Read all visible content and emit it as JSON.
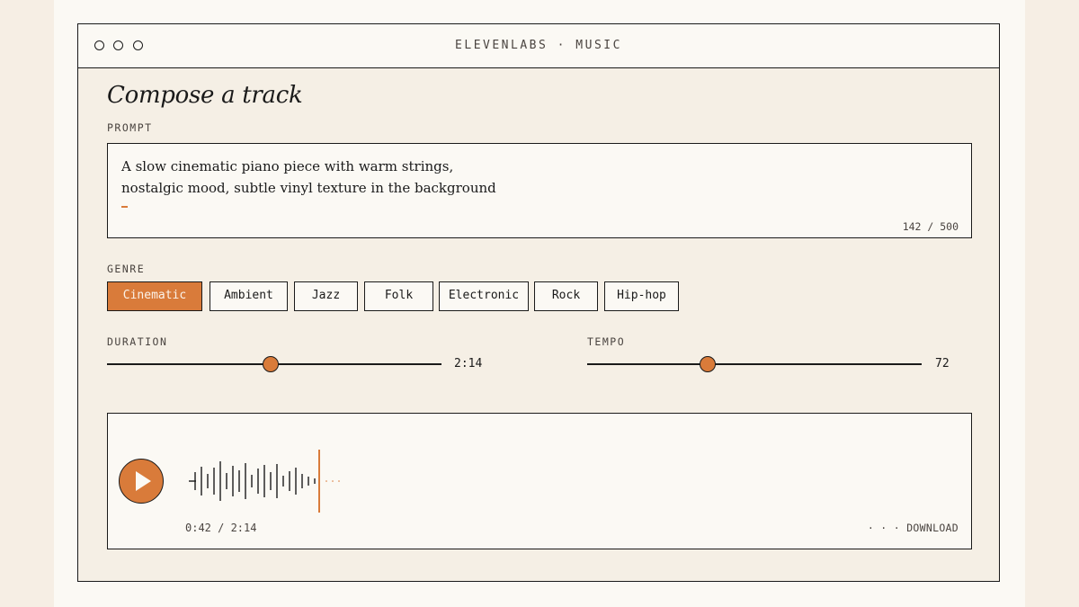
{
  "window": {
    "title": "ELEVENLABS · MUSIC"
  },
  "heading": "Compose a track",
  "prompt": {
    "label": "PROMPT",
    "text": "A slow cinematic piano piece with warm strings,\nnostalgic mood, subtle vinyl texture in the background",
    "counter": "142 / 500"
  },
  "genre": {
    "label": "GENRE",
    "options": [
      "Cinematic",
      "Ambient",
      "Jazz",
      "Folk",
      "Electronic",
      "Rock",
      "Hip-hop"
    ],
    "selected": "Cinematic"
  },
  "duration": {
    "label": "DURATION",
    "value": "2:14",
    "position": 0.49
  },
  "tempo": {
    "label": "TEMPO",
    "value": "72",
    "position": 0.36
  },
  "player": {
    "time": "0:42 / 2:14",
    "download": "· · · DOWNLOAD",
    "progress": 0.31
  },
  "colors": {
    "accent": "#d97b3a",
    "ink": "#1a1a1a",
    "panel": "#f5efe5",
    "paper": "#fbf9f4",
    "backdrop": "#f6eee4"
  },
  "icons": {
    "play": "play-icon",
    "window_controls": "circle-icon"
  }
}
